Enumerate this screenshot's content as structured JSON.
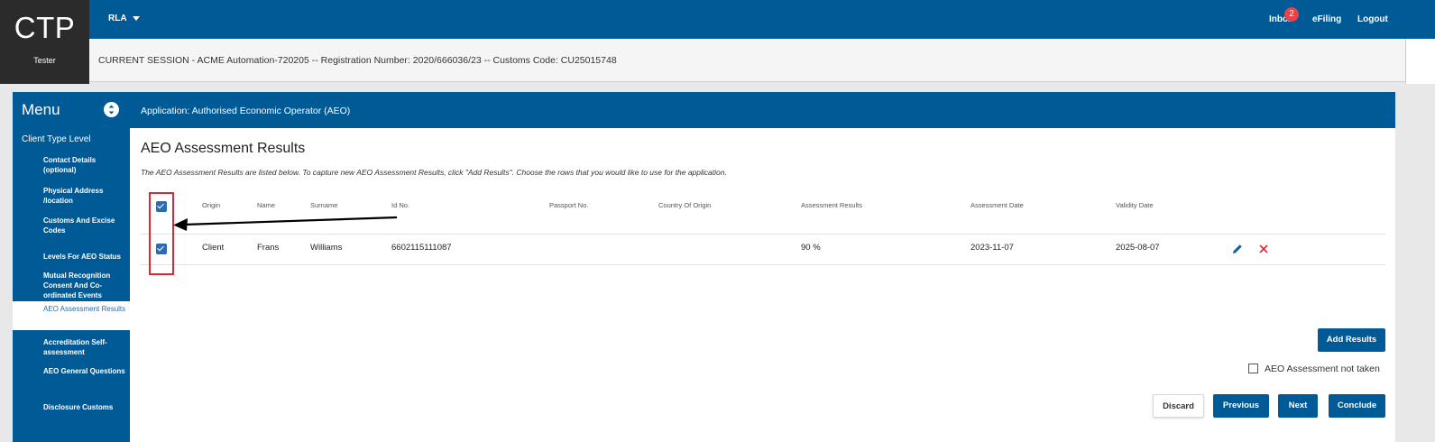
{
  "header": {
    "logo": "CTP",
    "user_role": "Tester",
    "rla_label": "RLA",
    "inbox_label": "Inbox",
    "inbox_count": "2",
    "efiling_label": "eFiling",
    "logout_label": "Logout",
    "session_text": "CURRENT SESSION - ACME Automation-720205 -- Registration Number: 2020/666036/23 -- Customs Code: CU25015748"
  },
  "sidebar": {
    "title": "Menu",
    "section": "Client Type Level",
    "items": [
      {
        "label": "Contact Details (optional)",
        "active": false
      },
      {
        "label": "Physical Address /location",
        "active": false
      },
      {
        "label": "Customs And Excise Codes",
        "active": false
      },
      {
        "label": "Levels For AEO Status",
        "active": false
      },
      {
        "label": "Mutual Recognition Consent And Co-ordinated Events",
        "active": false
      },
      {
        "label": "AEO Assessment Results",
        "active": true
      },
      {
        "label": "Accreditation Self-assessment",
        "active": false
      },
      {
        "label": "AEO General Questions",
        "active": false
      },
      {
        "label": "Disclosure Customs",
        "active": false
      }
    ]
  },
  "main": {
    "header": "Application: Authorised Economic Operator (AEO)",
    "title": "AEO Assessment Results",
    "description": "The AEO Assessment Results are listed below. To capture new AEO Assessment Results, click \"Add Results\". Choose the rows that you would like to use for the application.",
    "table": {
      "columns": [
        "Origin",
        "Name",
        "Surname",
        "Id No.",
        "Passport No.",
        "Country Of Origin",
        "Assessment Results",
        "Assessment Date",
        "Validity Date"
      ],
      "rows": [
        {
          "origin": "Client",
          "name": "Frans",
          "surname": "Williams",
          "id_no": "6602115111087",
          "passport_no": "",
          "country": "",
          "result": "90 %",
          "assessment_date": "2023-11-07",
          "validity_date": "2025-08-07",
          "selected": true
        }
      ],
      "select_all": true
    },
    "add_results_label": "Add Results",
    "not_taken_label": "AEO Assessment not taken",
    "not_taken_checked": false,
    "buttons": {
      "discard": "Discard",
      "previous": "Previous",
      "next": "Next",
      "conclude": "Conclude"
    }
  },
  "colors": {
    "brand": "#005a96",
    "danger": "#e0262f",
    "checkbox": "#2a6bb5"
  }
}
